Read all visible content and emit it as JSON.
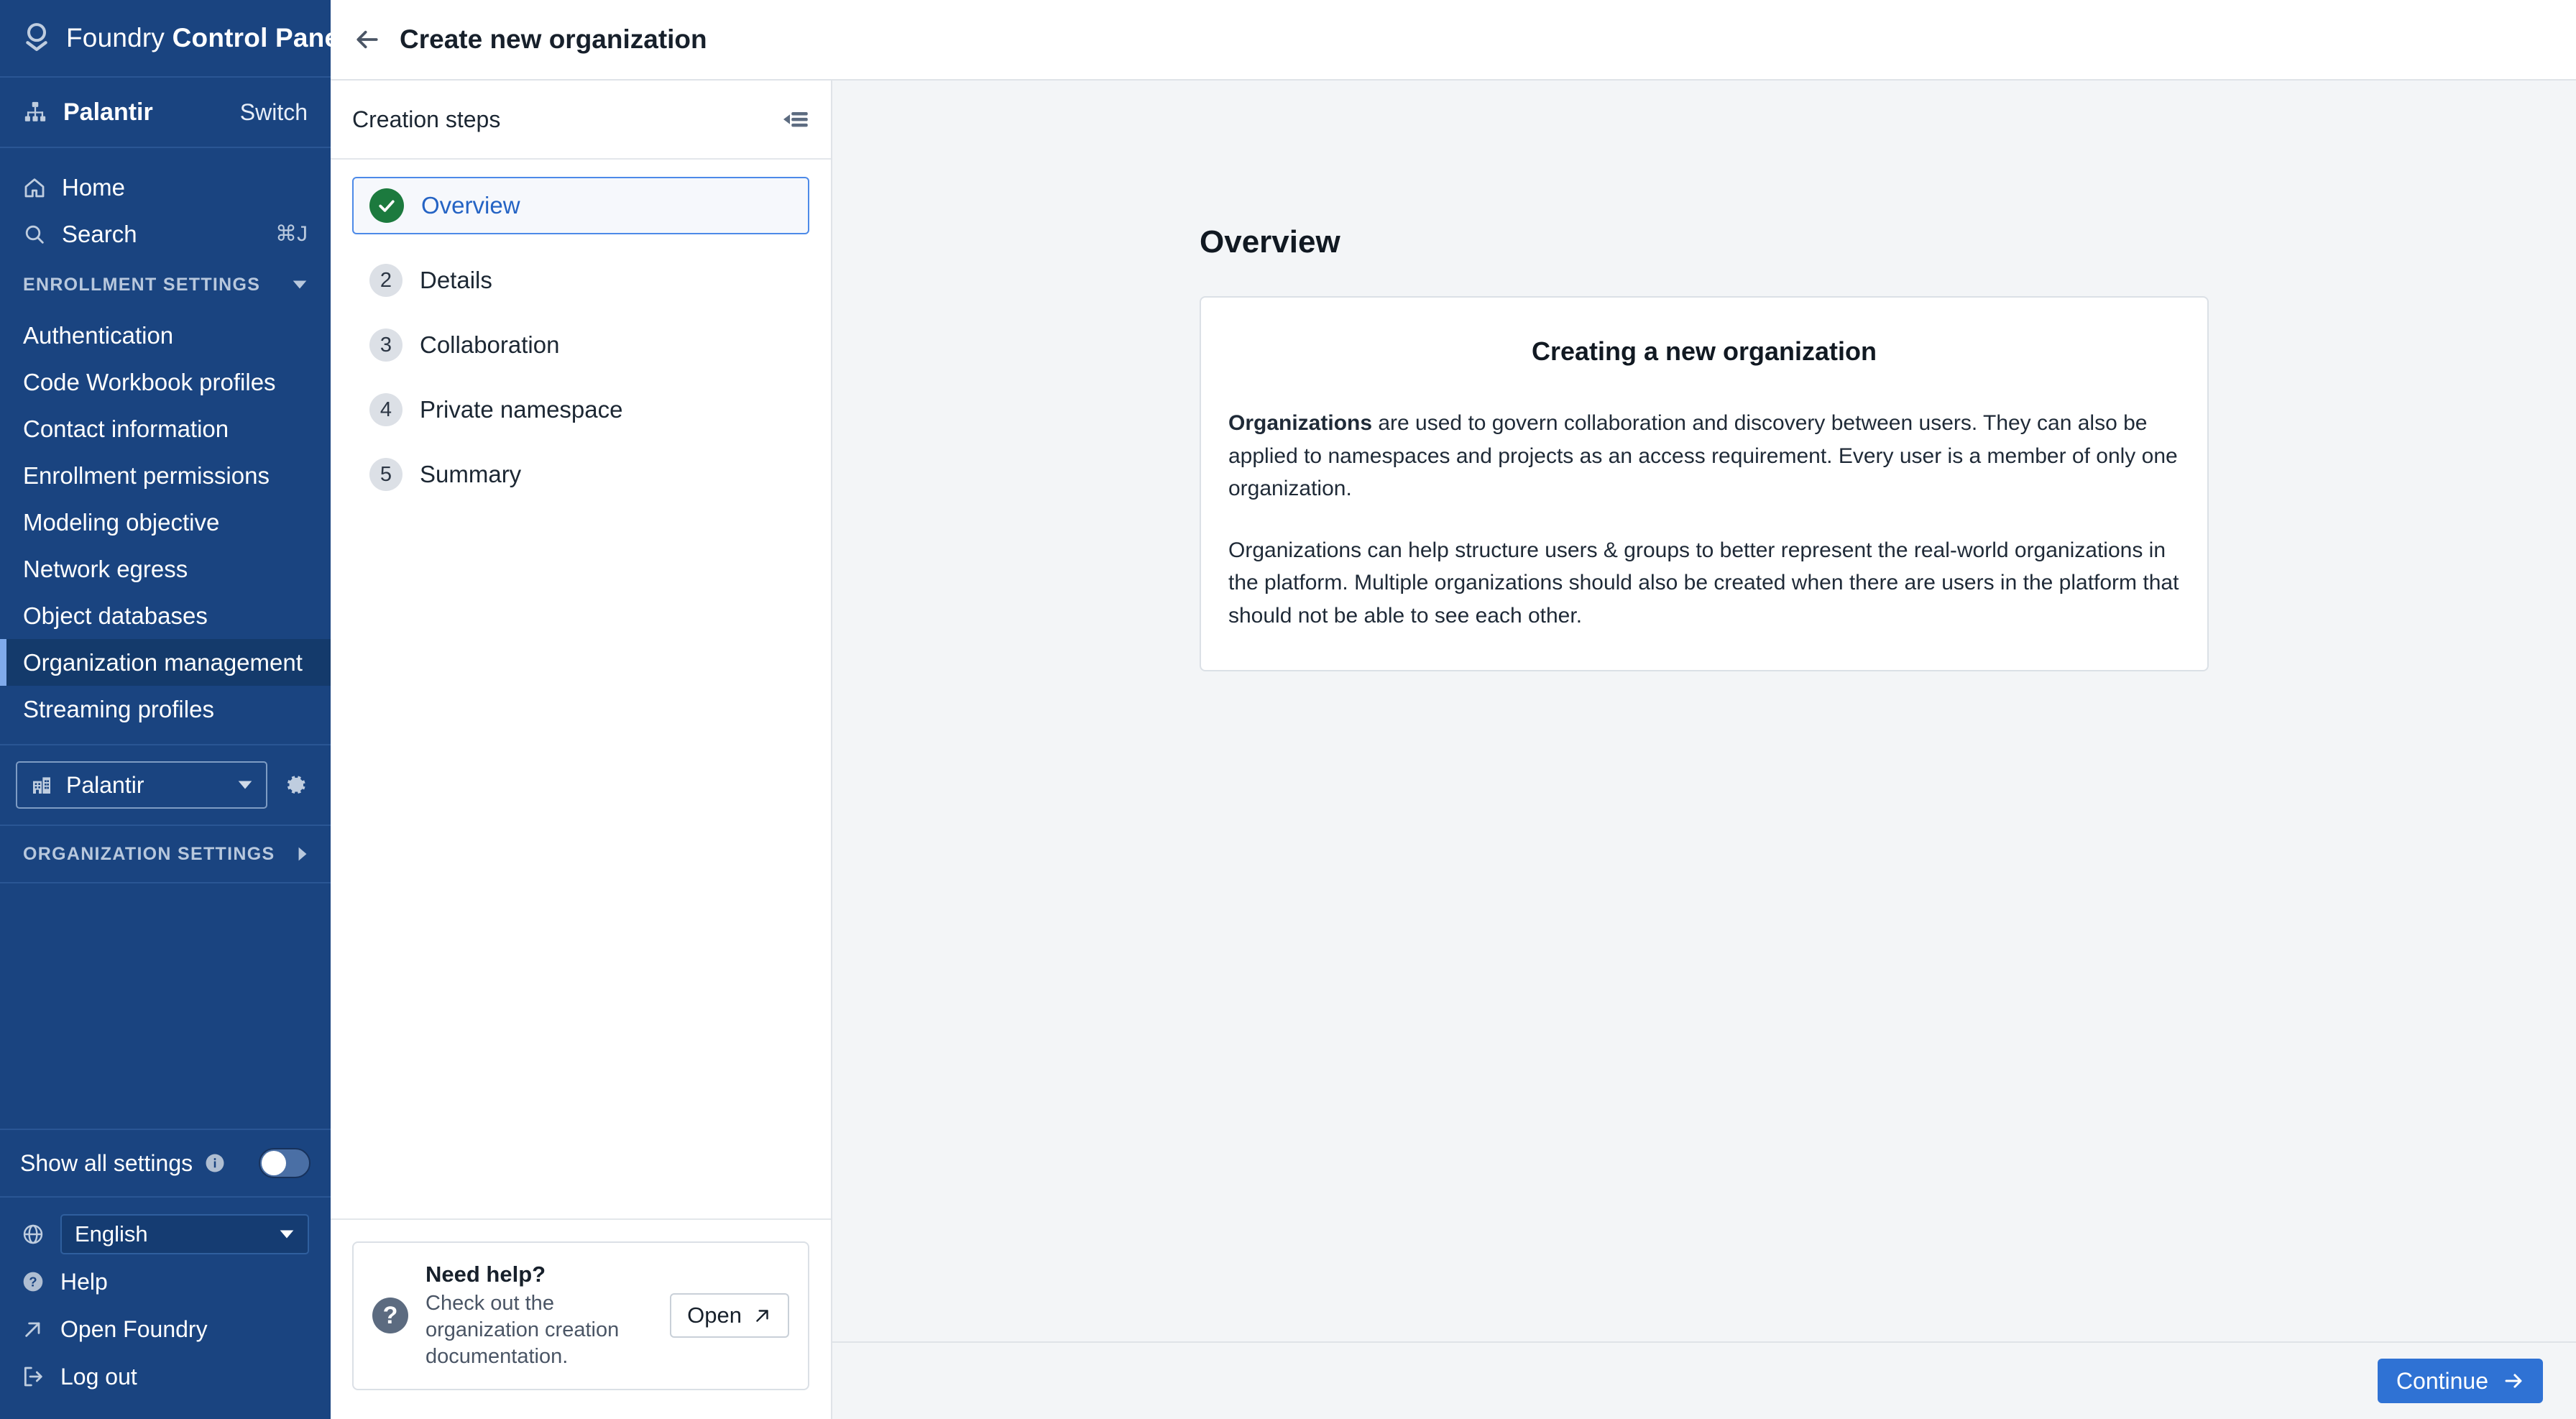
{
  "sidebar": {
    "brand": {
      "name_light": "Foundry ",
      "name_bold": "Control Panel",
      "logo_icon": "foundry-logo-icon"
    },
    "org_header": {
      "name": "Palantir",
      "switch_label": "Switch",
      "icon": "org-tree-icon"
    },
    "nav": [
      {
        "label": "Home",
        "icon": "home-icon",
        "shortcut": ""
      },
      {
        "label": "Search",
        "icon": "search-icon",
        "shortcut": "⌘J"
      }
    ],
    "enrollment_section": {
      "label": "ENROLLMENT SETTINGS",
      "caret": "chevron-down-icon"
    },
    "enrollment_items": [
      {
        "label": "Authentication",
        "active": false
      },
      {
        "label": "Code Workbook profiles",
        "active": false
      },
      {
        "label": "Contact information",
        "active": false
      },
      {
        "label": "Enrollment permissions",
        "active": false
      },
      {
        "label": "Modeling objective",
        "active": false
      },
      {
        "label": "Network egress",
        "active": false
      },
      {
        "label": "Object databases",
        "active": false
      },
      {
        "label": "Organization management",
        "active": true
      },
      {
        "label": "Streaming profiles",
        "active": false
      }
    ],
    "org_selector": {
      "value": "Palantir",
      "icon": "building-icon",
      "caret": "chevron-down-icon",
      "gear": "gear-icon"
    },
    "org_settings_section": {
      "label": "ORGANIZATION SETTINGS",
      "caret": "chevron-right-icon"
    },
    "show_all_settings": {
      "label": "Show all settings",
      "info_icon": "info-icon",
      "toggle_on": false
    },
    "footer": [
      {
        "label": "English",
        "icon": "globe-icon",
        "type": "select",
        "caret": "chevron-down-icon"
      },
      {
        "label": "Help",
        "icon": "help-circle-icon",
        "type": "link"
      },
      {
        "label": "Open Foundry",
        "icon": "external-link-icon",
        "type": "link"
      },
      {
        "label": "Log out",
        "icon": "logout-icon",
        "type": "link"
      }
    ]
  },
  "topbar": {
    "back_icon": "arrow-left-icon",
    "title": "Create new organization"
  },
  "steps_panel": {
    "header_label": "Creation steps",
    "collapse_icon": "collapse-panel-icon",
    "steps": [
      {
        "badge": "✓",
        "number": "",
        "label": "Overview",
        "state": "complete-active"
      },
      {
        "badge": "",
        "number": "2",
        "label": "Details",
        "state": "pending"
      },
      {
        "badge": "",
        "number": "3",
        "label": "Collaboration",
        "state": "pending"
      },
      {
        "badge": "",
        "number": "4",
        "label": "Private namespace",
        "state": "pending"
      },
      {
        "badge": "",
        "number": "5",
        "label": "Summary",
        "state": "pending"
      }
    ],
    "help_card": {
      "icon": "question-mark-icon",
      "title": "Need help?",
      "description": "Check out the organization creation documentation.",
      "button_label": "Open",
      "button_icon": "external-link-icon"
    }
  },
  "main": {
    "page_title": "Overview",
    "card": {
      "heading": "Creating a new organization",
      "para1_bold": "Organizations",
      "para1_rest": " are used to govern collaboration and discovery between users. They can also be applied to namespaces and projects as an access requirement. Every user is a member of only one organization.",
      "para2": "Organizations can help structure users & groups to better represent the real-world organizations in the platform. Multiple organizations should also be created when there are users in the platform that should not be able to see each other."
    }
  },
  "footerbar": {
    "continue_label": "Continue",
    "continue_icon": "arrow-right-icon"
  },
  "colors": {
    "sidebar_bg": "#1A4480",
    "sidebar_active_bg": "#143A6B",
    "sidebar_accent": "#7FAAEB",
    "primary_blue": "#2F72D4",
    "step_active_border": "#4D8AE8",
    "step_active_text": "#2463C4",
    "success_green": "#1C7A3E",
    "main_bg": "#F3F5F7"
  }
}
